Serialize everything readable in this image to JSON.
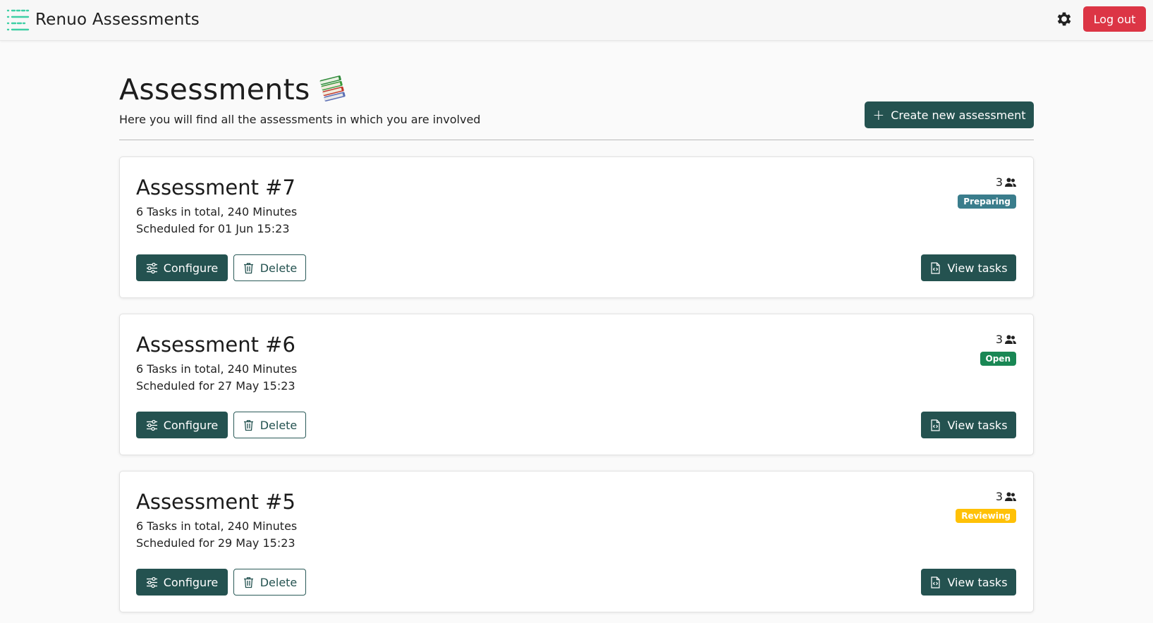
{
  "app": {
    "title": "Renuo Assessments",
    "logo_icon": "menu-lines-logo-icon"
  },
  "header": {
    "settings_icon": "gear-icon",
    "logout_label": "Log out",
    "logout_color": "#dc3545"
  },
  "page": {
    "title": "Assessments",
    "title_icon": "books-icon",
    "subtitle": "Here you will find all the assessments in which you are involved",
    "create_label": "Create new assessment",
    "accent_color": "#245250"
  },
  "assessments": [
    {
      "title": "Assessment #7",
      "tasks": "6 Tasks in total, 240 Minutes",
      "scheduled": "Scheduled for 01 Jun 15:23",
      "participants": "3",
      "status": "Preparing",
      "status_color": "#3a7d8c",
      "configure_label": "Configure",
      "delete_label": "Delete",
      "view_label": "View tasks"
    },
    {
      "title": "Assessment #6",
      "tasks": "6 Tasks in total, 240 Minutes",
      "scheduled": "Scheduled for 27 May 15:23",
      "participants": "3",
      "status": "Open",
      "status_color": "#198754",
      "configure_label": "Configure",
      "delete_label": "Delete",
      "view_label": "View tasks"
    },
    {
      "title": "Assessment #5",
      "tasks": "6 Tasks in total, 240 Minutes",
      "scheduled": "Scheduled for 29 May 15:23",
      "participants": "3",
      "status": "Reviewing",
      "status_color": "#ffc107",
      "configure_label": "Configure",
      "delete_label": "Delete",
      "view_label": "View tasks"
    }
  ]
}
